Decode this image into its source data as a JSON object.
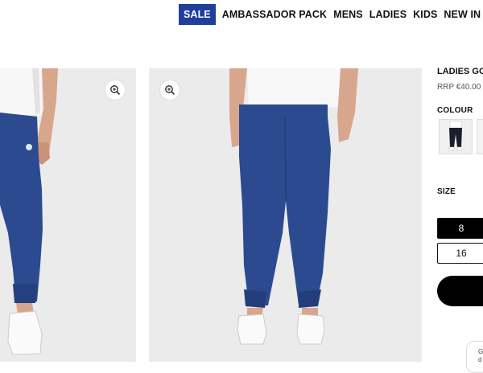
{
  "nav": {
    "sale": "SALE",
    "ambassador": "AMBASSADOR PACK",
    "mens": "MENS",
    "ladies": "LADIES",
    "kids": "KIDS",
    "new_in": "NEW IN"
  },
  "product": {
    "title": "LADIES GO",
    "price": "RRP €40.00"
  },
  "colour_label": "COLOUR",
  "size_label": "SIZE",
  "sizes": [
    "8",
    "16"
  ],
  "chat": {
    "line1": "G",
    "line2": "d"
  },
  "colors": {
    "brand_blue": "#1f3f99",
    "pants_navy": "#2c4a8f",
    "photo_bg": "#ebebeb"
  },
  "icons": {
    "zoom": "zoom-in-icon"
  }
}
